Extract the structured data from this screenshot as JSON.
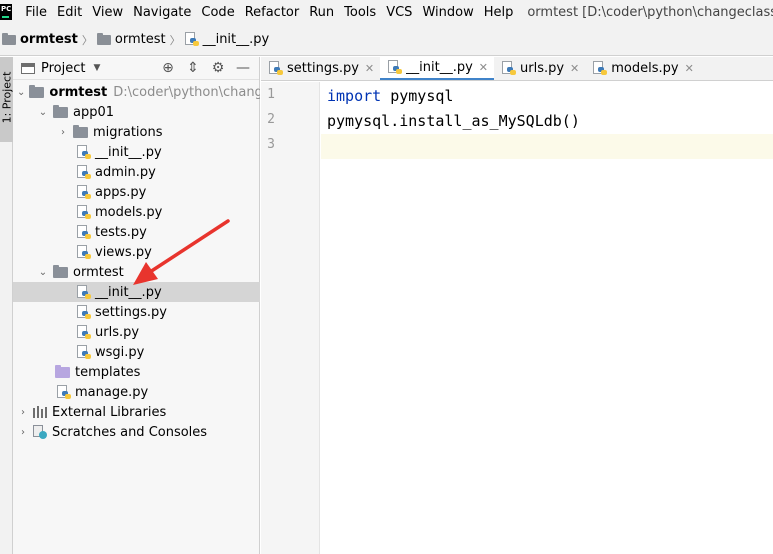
{
  "menubar": {
    "items": [
      {
        "label": "File"
      },
      {
        "label": "Edit"
      },
      {
        "label": "View"
      },
      {
        "label": "Navigate"
      },
      {
        "label": "Code"
      },
      {
        "label": "Refactor"
      },
      {
        "label": "Run"
      },
      {
        "label": "Tools"
      },
      {
        "label": "VCS"
      },
      {
        "label": "Window"
      },
      {
        "label": "Help"
      }
    ],
    "window_title": "ormtest [D:\\coder\\python\\changeclass\\Djang"
  },
  "breadcrumb": {
    "items": [
      "ormtest",
      "ormtest",
      "__init__.py"
    ]
  },
  "toolstrip": {
    "project_tab": "1: Project"
  },
  "project_panel": {
    "title": "Project",
    "tree": [
      {
        "label": "ormtest",
        "hint": "D:\\coder\\python\\changecl"
      },
      {
        "label": "app01"
      },
      {
        "label": "migrations"
      },
      {
        "label": "__init__.py"
      },
      {
        "label": "admin.py"
      },
      {
        "label": "apps.py"
      },
      {
        "label": "models.py"
      },
      {
        "label": "tests.py"
      },
      {
        "label": "views.py"
      },
      {
        "label": "ormtest"
      },
      {
        "label": "__init__.py"
      },
      {
        "label": "settings.py"
      },
      {
        "label": "urls.py"
      },
      {
        "label": "wsgi.py"
      },
      {
        "label": "templates"
      },
      {
        "label": "manage.py"
      },
      {
        "label": "External Libraries"
      },
      {
        "label": "Scratches and Consoles"
      }
    ]
  },
  "editor": {
    "tabs": [
      {
        "label": "settings.py"
      },
      {
        "label": "__init__.py"
      },
      {
        "label": "urls.py"
      },
      {
        "label": "models.py"
      }
    ],
    "line_numbers": [
      "1",
      "2",
      "3"
    ],
    "lines": [
      {
        "keyword": "import",
        "rest": " pymysql"
      },
      {
        "keyword": "",
        "rest": "pymysql.install_as_MySQLdb()"
      },
      {
        "keyword": "",
        "rest": ""
      }
    ]
  },
  "colors": {
    "accent": "#4083c9",
    "keyword": "#0033b3",
    "annotation_arrow": "#e8342d"
  }
}
